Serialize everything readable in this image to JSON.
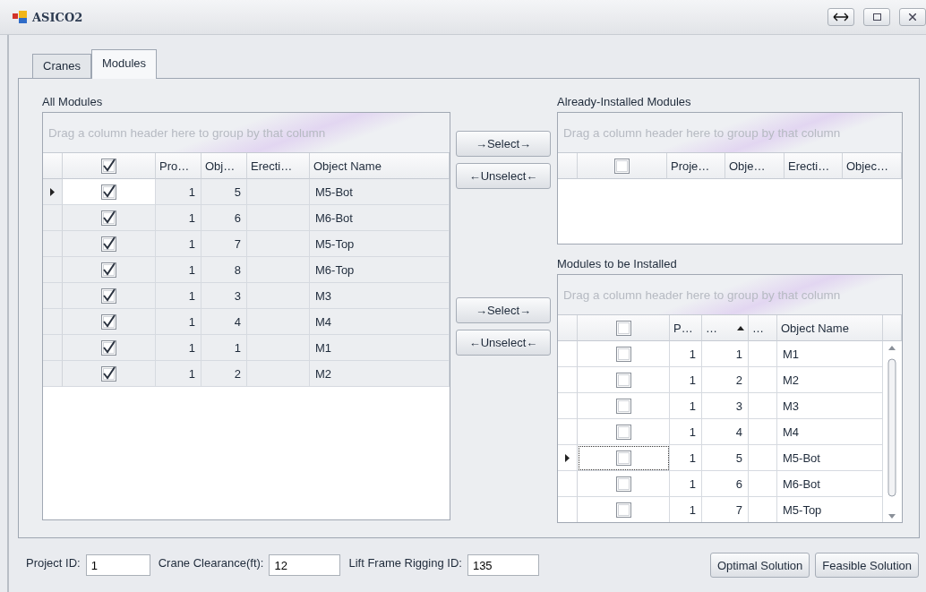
{
  "window": {
    "title": "ASICO2"
  },
  "tabs": [
    {
      "label": "Cranes",
      "selected": false
    },
    {
      "label": "Modules",
      "selected": true
    }
  ],
  "all_modules": {
    "title": "All Modules",
    "group_hint": "Drag a column header here to group by that column",
    "header_checked": true,
    "columns": [
      {
        "label": "Pro…"
      },
      {
        "label": "Obj…"
      },
      {
        "label": "Erecti…"
      },
      {
        "label": "Object Name"
      }
    ],
    "rows": [
      {
        "checked": true,
        "current": true,
        "cells": [
          "1",
          "5",
          "",
          "M5-Bot"
        ]
      },
      {
        "checked": true,
        "current": false,
        "cells": [
          "1",
          "6",
          "",
          "M6-Bot"
        ]
      },
      {
        "checked": true,
        "current": false,
        "cells": [
          "1",
          "7",
          "",
          "M5-Top"
        ]
      },
      {
        "checked": true,
        "current": false,
        "cells": [
          "1",
          "8",
          "",
          "M6-Top"
        ]
      },
      {
        "checked": true,
        "current": false,
        "cells": [
          "1",
          "3",
          "",
          "M3"
        ]
      },
      {
        "checked": true,
        "current": false,
        "cells": [
          "1",
          "4",
          "",
          "M4"
        ]
      },
      {
        "checked": true,
        "current": false,
        "cells": [
          "1",
          "1",
          "",
          "M1"
        ]
      },
      {
        "checked": true,
        "current": false,
        "cells": [
          "1",
          "2",
          "",
          "M2"
        ]
      }
    ]
  },
  "move_buttons": [
    [
      "→Select→",
      "←Unselect←"
    ],
    [
      "→Select→",
      "←Unselect←"
    ]
  ],
  "already_installed": {
    "title": "Already-Installed Modules",
    "group_hint": "Drag a column header here to group by that column",
    "header_checked": false,
    "columns": [
      {
        "label": "Proje…"
      },
      {
        "label": "Obje…"
      },
      {
        "label": "Erecti…"
      },
      {
        "label": "Objec…"
      }
    ]
  },
  "to_be_installed": {
    "title": "Modules to be Installed",
    "group_hint": "Drag a column header here to group by that column",
    "header_checked": false,
    "columns": [
      {
        "label": "P…",
        "sorted": false
      },
      {
        "label": "…",
        "sorted": true
      },
      {
        "label": "…",
        "sorted": false
      },
      {
        "label": "Object Name",
        "sorted": false
      }
    ],
    "rows": [
      {
        "checked": false,
        "current": false,
        "cells": [
          "1",
          "1",
          "",
          "M1"
        ]
      },
      {
        "checked": false,
        "current": false,
        "cells": [
          "1",
          "2",
          "",
          "M2"
        ]
      },
      {
        "checked": false,
        "current": false,
        "cells": [
          "1",
          "3",
          "",
          "M3"
        ]
      },
      {
        "checked": false,
        "current": false,
        "cells": [
          "1",
          "4",
          "",
          "M4"
        ]
      },
      {
        "checked": false,
        "current": true,
        "cells": [
          "1",
          "5",
          "",
          "M5-Bot"
        ]
      },
      {
        "checked": false,
        "current": false,
        "cells": [
          "1",
          "6",
          "",
          "M6-Bot"
        ]
      },
      {
        "checked": false,
        "current": false,
        "cells": [
          "1",
          "7",
          "",
          "M5-Top"
        ]
      }
    ]
  },
  "fields": [
    {
      "label": "Project ID:",
      "value": "1"
    },
    {
      "label": "Crane Clearance(ft):",
      "value": "12"
    },
    {
      "label": "Lift Frame Rigging ID:",
      "value": "135"
    }
  ],
  "buttons": [
    "Optimal Solution",
    "Feasible Solution"
  ]
}
